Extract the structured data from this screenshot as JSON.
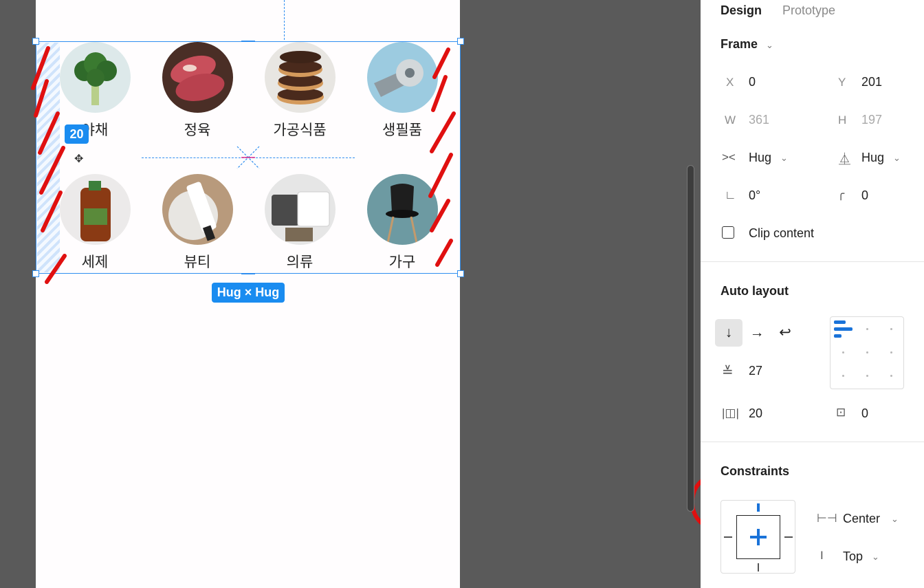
{
  "canvas": {
    "gap_badge": "20",
    "size_badge": "Hug × Hug",
    "items": [
      {
        "label": "야채",
        "image": "broccoli"
      },
      {
        "label": "정육",
        "image": "meat"
      },
      {
        "label": "가공식품",
        "image": "donuts"
      },
      {
        "label": "생필품",
        "image": "toilet-paper"
      },
      {
        "label": "세제",
        "image": "detergent"
      },
      {
        "label": "뷰티",
        "image": "cosmetic-tube"
      },
      {
        "label": "의류",
        "image": "clothes"
      },
      {
        "label": "가구",
        "image": "chair"
      }
    ],
    "annotations": {
      "circle_1": "1",
      "circle_2": "2"
    }
  },
  "panel": {
    "tabs": {
      "design": "Design",
      "prototype": "Prototype"
    },
    "frame": {
      "title": "Frame",
      "x_label": "X",
      "x_value": "0",
      "y_label": "Y",
      "y_value": "201",
      "w_label": "W",
      "w_value": "361",
      "h_label": "H",
      "h_value": "197",
      "width_mode": "Hug",
      "height_mode": "Hug",
      "rotation": "0°",
      "corner_radius": "0",
      "clip_content": "Clip content"
    },
    "auto_layout": {
      "title": "Auto layout",
      "spacing": "27",
      "horizontal_padding": "20",
      "vertical_padding": "0"
    },
    "constraints": {
      "title": "Constraints",
      "horizontal": "Center",
      "vertical": "Top"
    }
  },
  "colors": {
    "selection": "#2f8ef0",
    "badge": "#1a8cf0",
    "annotation": "#e01010",
    "canvas_bg": "#5a5a5a"
  }
}
